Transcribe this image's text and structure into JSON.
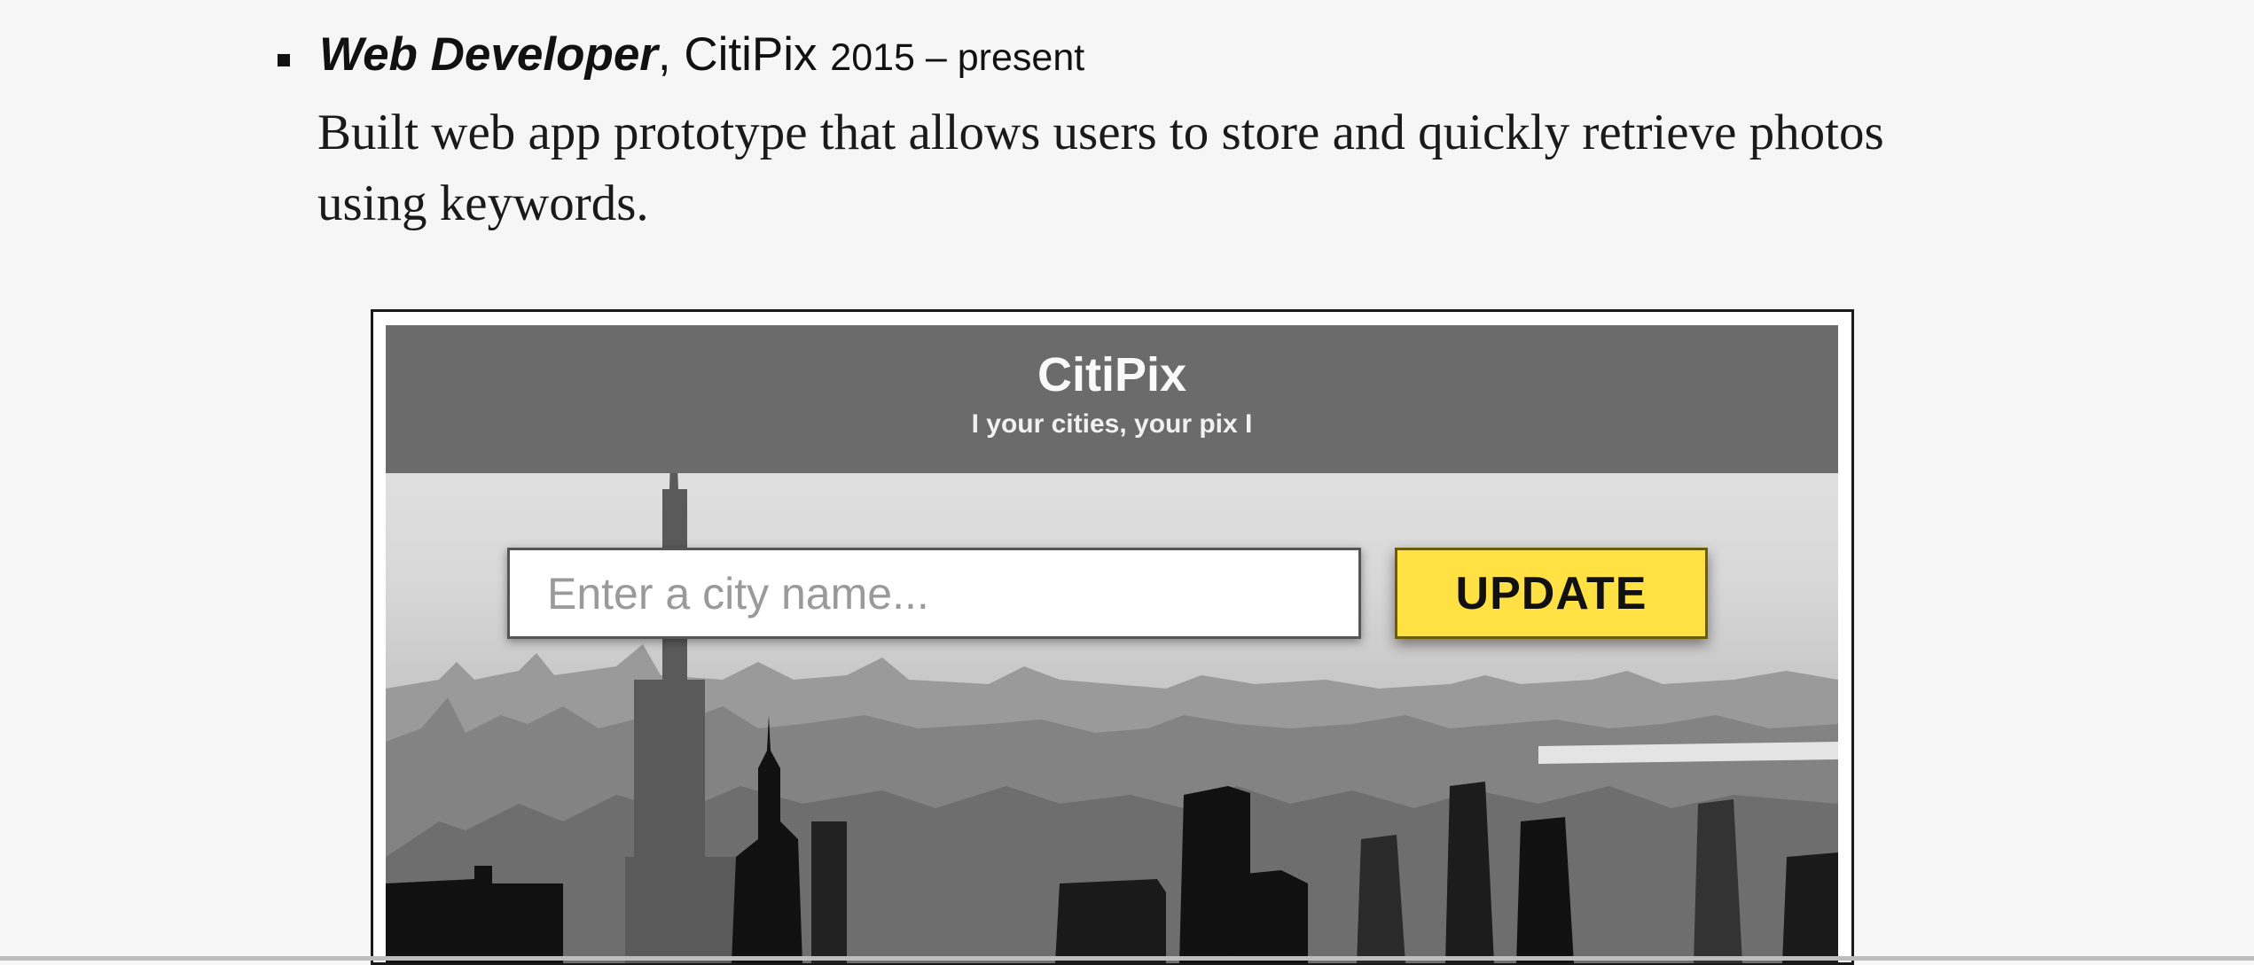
{
  "entry": {
    "job_title": "Web Developer",
    "company": "CitiPix",
    "years": "2015 – present",
    "description": "Built web app prototype that allows users to store and quickly retrieve photos using keywords."
  },
  "app_screenshot": {
    "brand": "CitiPix",
    "tagline": "I your cities, your pix I",
    "search_placeholder": "Enter a city name...",
    "update_label": "UPDATE",
    "colors": {
      "header_band": "#6b6b6b",
      "button_yellow": "#ffe144",
      "page_background": "#f6f6f6"
    }
  }
}
